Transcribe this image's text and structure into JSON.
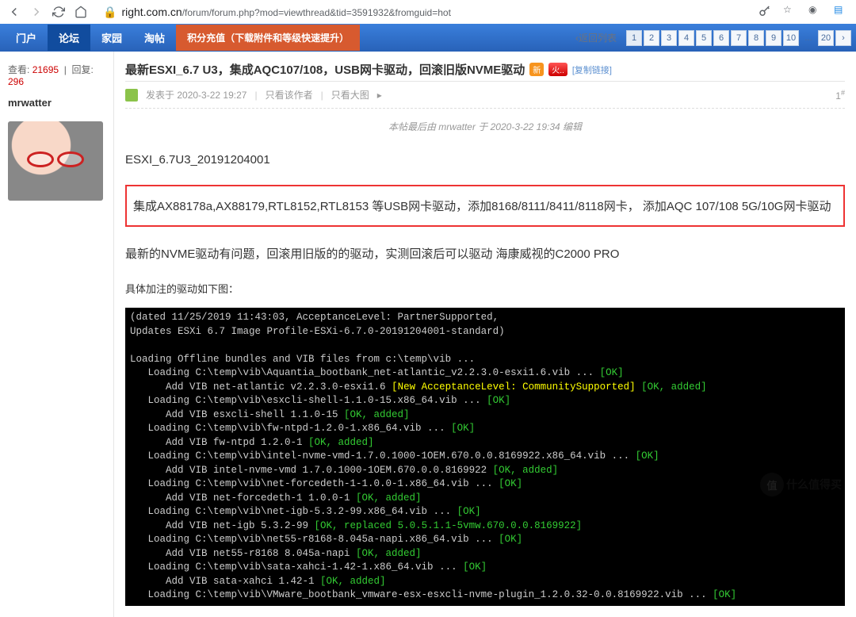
{
  "browser": {
    "url_host": "right.com.cn",
    "url_path": "/forum/forum.php?mod=viewthread&tid=3591932&fromguid=hot"
  },
  "nav": {
    "items": [
      "门户",
      "论坛",
      "家园",
      "淘帖"
    ],
    "active_index": 1,
    "credit": "积分充值（下载附件和等级快速提升）",
    "back_list": "返回列表",
    "pages": [
      "1",
      "2",
      "3",
      "4",
      "5",
      "6",
      "7",
      "8",
      "9",
      "10"
    ],
    "page_dots": "...",
    "page_last": "20",
    "page_next": "›"
  },
  "sidebar": {
    "views_label": "查看:",
    "views": "21695",
    "replies_label": "回复:",
    "replies": "296",
    "author": "mrwatter"
  },
  "thread": {
    "title": "最新ESXI_6.7 U3，集成AQC107/108，USB网卡驱动，回滚旧版NVME驱动",
    "badge_new": "新",
    "badge_hot": "火..",
    "copy_link": "[复制链接]",
    "posted_label": "发表于",
    "posted_time": "2020-3-22 19:27",
    "only_author": "只看该作者",
    "only_big": "只看大图",
    "floor": "1",
    "floor_sup": "#",
    "edited": "本帖最后由 mrwatter 于 2020-3-22 19:34 编辑",
    "line1": "ESXI_6.7U3_20191204001",
    "highlight": "集成AX88178a,AX88179,RTL8152,RTL8153 等USB网卡驱动，添加8168/8111/8411/8118网卡，  添加AQC 107/108 5G/10G网卡驱动",
    "line2": "最新的NVME驱动有问题，回滚用旧版的的驱动，实测回滚后可以驱动 海康威视的C2000 PRO",
    "line3": "具体加注的驱动如下图："
  },
  "terminal": {
    "l1a": "(dated 11/25/2019 11:43:03, AcceptanceLevel: PartnerSupported,",
    "l1b": "Updates ESXi 6.7 Image Profile-ESXi-6.7.0-20191204001-standard)",
    "l2": "Loading Offline bundles and VIB files from c:\\temp\\vib ...",
    "l3": "   Loading C:\\temp\\vib\\Aquantia_bootbank_net-atlantic_v2.2.3.0-esxi1.6.vib ... ",
    "l3ok": "[OK]",
    "l4": "      Add VIB net-atlantic v2.2.3.0-esxi1.6 ",
    "l4new": "[New AcceptanceLevel: CommunitySupported]",
    "l4ok": " [OK, added]",
    "l5": "   Loading C:\\temp\\vib\\esxcli-shell-1.1.0-15.x86_64.vib ... ",
    "l5ok": "[OK]",
    "l6": "      Add VIB esxcli-shell 1.1.0-15 ",
    "l6ok": "[OK, added]",
    "l7": "   Loading C:\\temp\\vib\\fw-ntpd-1.2.0-1.x86_64.vib ... ",
    "l7ok": "[OK]",
    "l8": "      Add VIB fw-ntpd 1.2.0-1 ",
    "l8ok": "[OK, added]",
    "l9": "   Loading C:\\temp\\vib\\intel-nvme-vmd-1.7.0.1000-1OEM.670.0.0.8169922.x86_64.vib ... ",
    "l9ok": "[OK]",
    "l10": "      Add VIB intel-nvme-vmd 1.7.0.1000-1OEM.670.0.0.8169922 ",
    "l10ok": "[OK, added]",
    "l11": "   Loading C:\\temp\\vib\\net-forcedeth-1-1.0.0-1.x86_64.vib ... ",
    "l11ok": "[OK]",
    "l12": "      Add VIB net-forcedeth-1 1.0.0-1 ",
    "l12ok": "[OK, added]",
    "l13": "   Loading C:\\temp\\vib\\net-igb-5.3.2-99.x86_64.vib ... ",
    "l13ok": "[OK]",
    "l14": "      Add VIB net-igb 5.3.2-99 ",
    "l14ok": "[OK, replaced 5.0.5.1.1-5vmw.670.0.0.8169922]",
    "l15": "   Loading C:\\temp\\vib\\net55-r8168-8.045a-napi.x86_64.vib ... ",
    "l15ok": "[OK]",
    "l16": "      Add VIB net55-r8168 8.045a-napi ",
    "l16ok": "[OK, added]",
    "l17": "   Loading C:\\temp\\vib\\sata-xahci-1.42-1.x86_64.vib ... ",
    "l17ok": "[OK]",
    "l18": "      Add VIB sata-xahci 1.42-1 ",
    "l18ok": "[OK, added]",
    "l19": "   Loading C:\\temp\\vib\\VMware_bootbank_vmware-esx-esxcli-nvme-plugin_1.2.0.32-0.0.8169922.vib ... ",
    "l19ok": "[OK]"
  },
  "watermark": {
    "text": "什么值得买",
    "icon": "值"
  }
}
